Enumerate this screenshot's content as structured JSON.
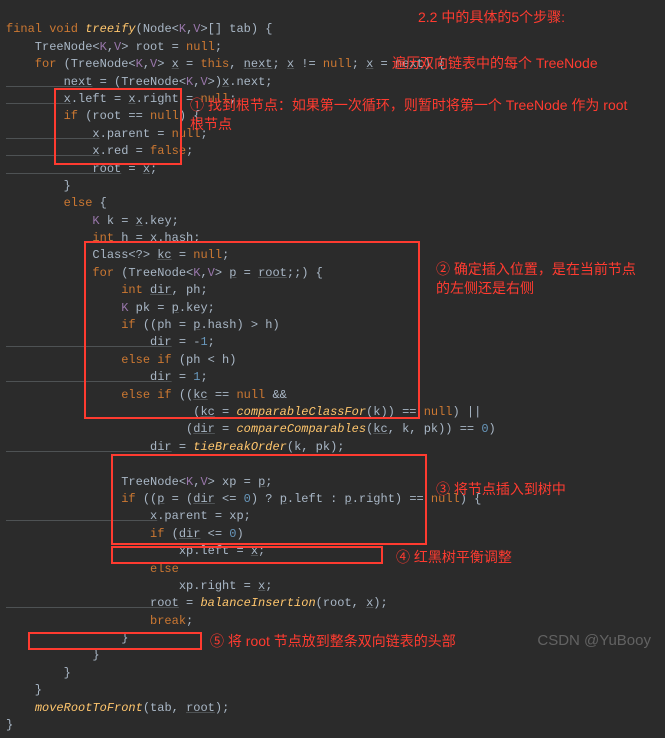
{
  "annotations": {
    "top_title": "2.2 中的具体的5个步骤:",
    "loop_note": "遍历双向链表中的每个 TreeNode",
    "step1": "① 找到根节点：如果第一次循环，则暂时将第一个 TreeNode 作为 root 根节点",
    "step2": "② 确定插入位置，是在当前节点的左侧还是右侧",
    "step3": "③ 将节点插入到树中",
    "step4": "④ 红黑树平衡调整",
    "step5": "⑤ 将 root 节点放到整条双向链表的头部"
  },
  "watermark": "CSDN @YuBooy",
  "code": {
    "l01_a": "final void ",
    "l01_b": "treeify",
    "l01_c": "(Node<",
    "l01_d": "K",
    "l01_e": ",",
    "l01_f": "V",
    "l01_g": ">[] tab) {",
    "l02_a": "    TreeNode<",
    "l02_b": "K",
    "l02_c": ",",
    "l02_d": "V",
    "l02_e": "> root = ",
    "l02_f": "null",
    "l02_g": ";",
    "l03_a": "    for ",
    "l03_b": "(TreeNode<",
    "l03_c": "K",
    "l03_d": ",",
    "l03_e": "V",
    "l03_f": "> ",
    "l03_g": "x",
    "l03_h": " = ",
    "l03_i": "this",
    "l03_j": ", ",
    "l03_k": "next",
    "l03_l": "; ",
    "l03_m": "x",
    "l03_n": " != ",
    "l03_o": "null",
    "l03_p": "; ",
    "l03_q": "x",
    "l03_r": " = ",
    "l03_s": "next",
    "l03_t": ") {",
    "l04_a": "        next",
    "l04_b": " = (TreeNode<",
    "l04_c": "K",
    "l04_d": ",",
    "l04_e": "V",
    "l04_f": ">)",
    "l04_g": "x",
    "l04_h": ".next;",
    "l05_a": "        x",
    "l05_b": ".left = ",
    "l05_c": "x",
    "l05_d": ".right = ",
    "l05_e": "null",
    "l05_f": ";",
    "l06_a": "        if ",
    "l06_b": "(root == ",
    "l06_c": "null",
    "l06_d": ") {",
    "l07_a": "            x",
    "l07_b": ".parent = ",
    "l07_c": "null",
    "l07_d": ";",
    "l08_a": "            x",
    "l08_b": ".red = ",
    "l08_c": "false",
    "l08_d": ";",
    "l09_a": "            root",
    "l09_b": " = ",
    "l09_c": "x",
    "l09_d": ";",
    "l10_a": "        }",
    "l11_a": "        else ",
    "l11_b": "{",
    "l12_a": "            K",
    "l12_b": " k = ",
    "l12_c": "x",
    "l12_d": ".key;",
    "l13_a": "            int ",
    "l13_b": "h = ",
    "l13_c": "x",
    "l13_d": ".hash;",
    "l14_a": "            Class<?> ",
    "l14_b": "kc",
    "l14_c": " = ",
    "l14_d": "null",
    "l14_e": ";",
    "l15_a": "            for ",
    "l15_b": "(TreeNode<",
    "l15_c": "K",
    "l15_d": ",",
    "l15_e": "V",
    "l15_f": "> ",
    "l15_g": "p",
    "l15_h": " = ",
    "l15_i": "root",
    "l15_j": ";;) {",
    "l16_a": "                int ",
    "l16_b": "dir",
    "l16_c": ", ph;",
    "l17_a": "                K",
    "l17_b": " pk = ",
    "l17_c": "p",
    "l17_d": ".key;",
    "l18_a": "                if ",
    "l18_b": "((ph = ",
    "l18_c": "p",
    "l18_d": ".hash) > h)",
    "l19_a": "                    dir",
    "l19_b": " = -",
    "l19_c": "1",
    "l19_d": ";",
    "l20_a": "                else if ",
    "l20_b": "(ph < h)",
    "l21_a": "                    dir",
    "l21_b": " = ",
    "l21_c": "1",
    "l21_d": ";",
    "l22_a": "                else if ",
    "l22_b": "((",
    "l22_c": "kc",
    "l22_d": " == ",
    "l22_e": "null",
    "l22_f": " &&",
    "l23_a": "                          (",
    "l23_b": "kc",
    "l23_c": " = ",
    "l23_d": "comparableClassFor",
    "l23_e": "(k)) == ",
    "l23_f": "null",
    "l23_g": ") ||",
    "l24_a": "                         (",
    "l24_b": "dir",
    "l24_c": " = ",
    "l24_d": "compareComparables",
    "l24_e": "(",
    "l24_f": "kc",
    "l24_g": ", k, pk)) == ",
    "l24_h": "0",
    "l24_i": ")",
    "l25_a": "                    dir",
    "l25_b": " = ",
    "l25_c": "tieBreakOrder",
    "l25_d": "(k, pk);",
    "l26_a": "",
    "l27_a": "                TreeNode<",
    "l27_b": "K",
    "l27_c": ",",
    "l27_d": "V",
    "l27_e": "> xp = ",
    "l27_f": "p",
    "l27_g": ";",
    "l28_a": "                if ",
    "l28_b": "((",
    "l28_c": "p",
    "l28_d": " = (",
    "l28_e": "dir",
    "l28_f": " <= ",
    "l28_g": "0",
    "l28_h": ") ? ",
    "l28_i": "p",
    "l28_j": ".left : ",
    "l28_k": "p",
    "l28_l": ".right) == ",
    "l28_m": "null",
    "l28_n": ") {",
    "l29_a": "                    x",
    "l29_b": ".parent = xp;",
    "l30_a": "                    if ",
    "l30_b": "(",
    "l30_c": "dir",
    "l30_d": " <= ",
    "l30_e": "0",
    "l30_f": ")",
    "l31_a": "                        xp.left = ",
    "l31_b": "x",
    "l31_c": ";",
    "l32_a": "                    else",
    "l33_a": "                        xp.right = ",
    "l33_b": "x",
    "l33_c": ";",
    "l34_a": "                    root",
    "l34_b": " = ",
    "l34_c": "balanceInsertion",
    "l34_d": "(root, ",
    "l34_e": "x",
    "l34_f": ");",
    "l35_a": "                    break",
    "l35_b": ";",
    "l36_a": "                }",
    "l37_a": "            }",
    "l38_a": "        }",
    "l39_a": "    }",
    "l40_a": "    ",
    "l40_b": "moveRootToFront",
    "l40_c": "(tab, ",
    "l40_d": "root",
    "l40_e": ");",
    "l41_a": "}"
  }
}
